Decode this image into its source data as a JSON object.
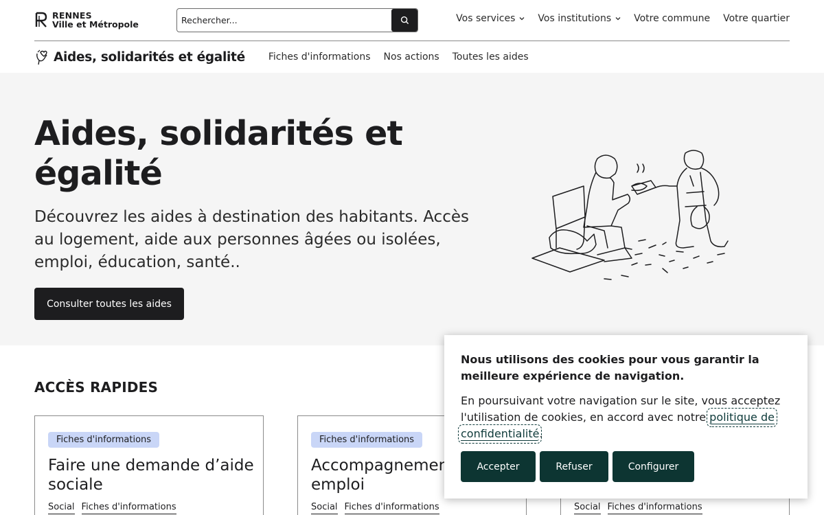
{
  "header": {
    "logo_line1": "RENNES",
    "logo_line2": "Ville et Métropole",
    "search_placeholder": "Rechercher...",
    "nav": [
      {
        "label": "Vos services",
        "has_dropdown": true
      },
      {
        "label": "Vos institutions",
        "has_dropdown": true
      },
      {
        "label": "Votre commune",
        "has_dropdown": false
      },
      {
        "label": "Votre quartier",
        "has_dropdown": false
      }
    ]
  },
  "subheader": {
    "title": "Aides, solidarités et égalité",
    "nav": [
      "Fiches d'informations",
      "Nos actions",
      "Toutes les aides"
    ]
  },
  "hero": {
    "title": "Aides, solidarités et égalité",
    "description": "Découvrez les aides à destination des habitants. Accès au logement, aide aux personnes âgées ou isolées, emploi, éducation, santé..",
    "cta": "Consulter toutes les aides"
  },
  "quick_access": {
    "title": "ACCÈS RAPIDES",
    "cards": [
      {
        "badge": "Fiches d'informations",
        "title": "Faire une demande d’aide sociale",
        "tags": [
          "Social",
          "Fiches d'informations"
        ]
      },
      {
        "badge": "Fiches d'informations",
        "title": "Accompagnement et emploi",
        "tags": [
          "Social",
          "Fiches d'informations"
        ]
      },
      {
        "badge": "",
        "title": "",
        "tags": [
          "Social",
          "Fiches d'informations"
        ]
      }
    ]
  },
  "cookie": {
    "title": "Nous utilisons des cookies pour vous garantir la meilleure expérience de navigation.",
    "text": "En poursuivant votre navigation sur le site, vous acceptez l'utilisation de cookies, en accord avec notre ",
    "link": "politique de confidentialité",
    "text_end": ".",
    "accept": "Accepter",
    "refuse": "Refuser",
    "configure": "Configurer"
  },
  "colors": {
    "primary_dark": "#1d1d1f",
    "cookie_button": "#0d3532",
    "badge_bg": "#c9d6f7",
    "hero_bg": "#f5f5f5"
  },
  "icons": {
    "search": "search-icon",
    "chevron": "chevron-down-icon",
    "logo": "rennes-logo-icon",
    "section": "hand-heart-icon"
  }
}
